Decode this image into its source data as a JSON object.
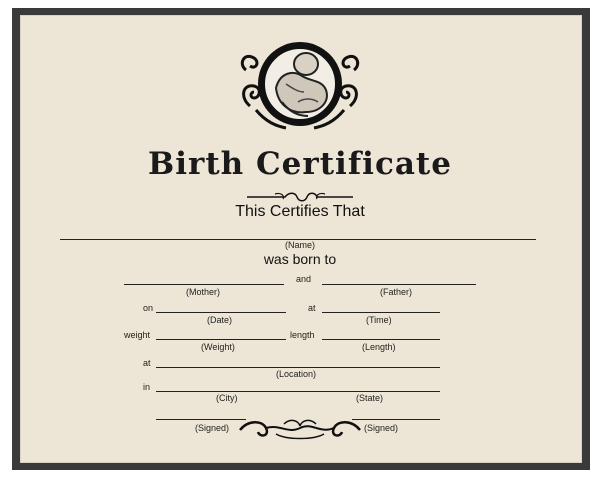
{
  "certificate": {
    "title": "Birth Certificate",
    "subtitle": "This Certifies That",
    "name_caption": "(Name)",
    "born_text": "was born to",
    "and_word": "and",
    "mother_caption": "(Mother)",
    "father_caption": "(Father)",
    "on_word": "on",
    "at_word": "at",
    "date_caption": "(Date)",
    "time_caption": "(Time)",
    "weight_word": "weight",
    "length_word": "length",
    "weight_caption": "(Weight)",
    "length_caption": "(Length)",
    "location_caption": "(Location)",
    "in_word": "in",
    "city_caption": "(City)",
    "state_caption": "(State)",
    "signed_caption_left": "(Signed)",
    "signed_caption_right": "(Signed)"
  },
  "icons": {
    "emblem": "cherub-medallion-icon",
    "title_flourish": "scroll-flourish-icon",
    "bottom_flourish": "scroll-flourish-icon"
  },
  "colors": {
    "frame": "#3a3a3a",
    "paper": "#ede6d6",
    "ink": "#1a1a1a"
  }
}
